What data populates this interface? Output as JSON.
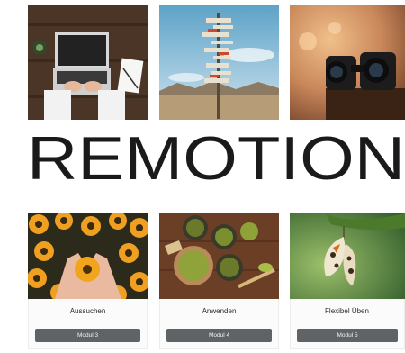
{
  "logo": {
    "text": "REMOTION"
  },
  "cards": [
    {
      "label": "Aussuchen",
      "button": "Modul 3"
    },
    {
      "label": "Anwenden",
      "button": "Modul 4"
    },
    {
      "label": "Flexibel Üben",
      "button": "Modul 5"
    }
  ],
  "colors": {
    "button_bg": "#5e6366",
    "logo_text": "#1a1a1a"
  }
}
